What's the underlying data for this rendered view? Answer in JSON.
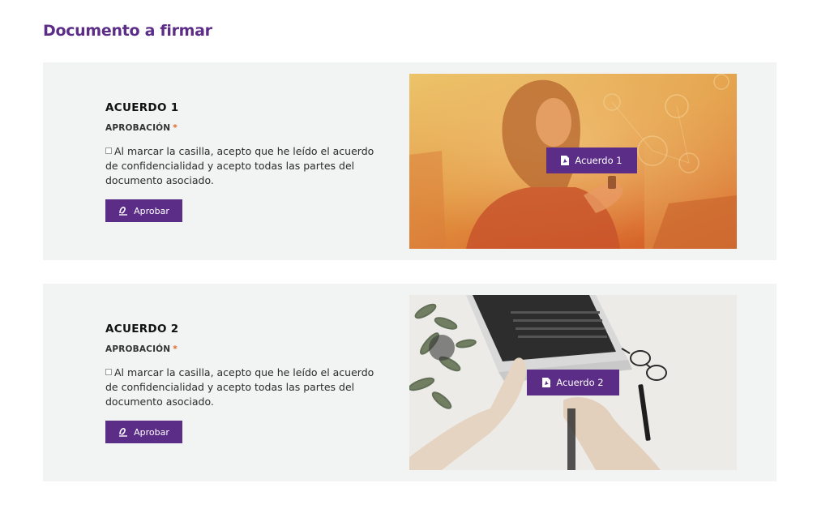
{
  "page": {
    "title": "Documento a firmar"
  },
  "agreements": [
    {
      "heading": "ACUERDO 1",
      "label": "APROBACIÓN",
      "required_mark": "*",
      "consent_text": "Al marcar la casilla, acepto que he leído el acuerdo de confidencialidad y acepto todas las partes del documento asociado.",
      "approve_label": "Aprobar",
      "document_button_label": "Acuerdo 1",
      "image": "woman-with-phone-photo"
    },
    {
      "heading": "ACUERDO 2",
      "label": "APROBACIÓN",
      "required_mark": "*",
      "consent_text": "Al marcar la casilla, acepto que he leído el acuerdo de confidencialidad y acepto todas las partes del documento asociado.",
      "approve_label": "Aprobar",
      "document_button_label": "Acuerdo 2",
      "image": "laptop-desk-photo"
    }
  ],
  "icons": {
    "approve": "signature-icon",
    "document": "pdf-file-icon"
  },
  "colors": {
    "accent": "#5b2d87",
    "required": "#e06b2a",
    "card_bg": "#f2f3f3"
  }
}
